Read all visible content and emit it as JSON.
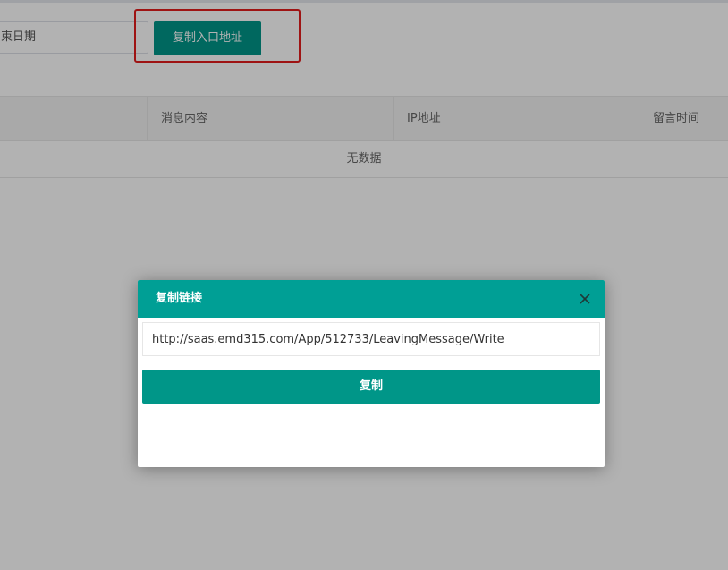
{
  "filters": {
    "end_date_placeholder": "束日期"
  },
  "toolbar": {
    "copy_entry_label": "复制入口地址"
  },
  "table": {
    "columns": [
      "消息内容",
      "IP地址",
      "留言时间"
    ],
    "empty_text": "无数据"
  },
  "dialog": {
    "title": "复制链接",
    "url_value": "http://saas.emd315.com/App/512733/LeavingMessage/Write",
    "copy_label": "复制"
  },
  "colors": {
    "accent": "#009688",
    "header": "#009f95",
    "highlight": "#e21c1c",
    "close_icon": "close-icon"
  }
}
